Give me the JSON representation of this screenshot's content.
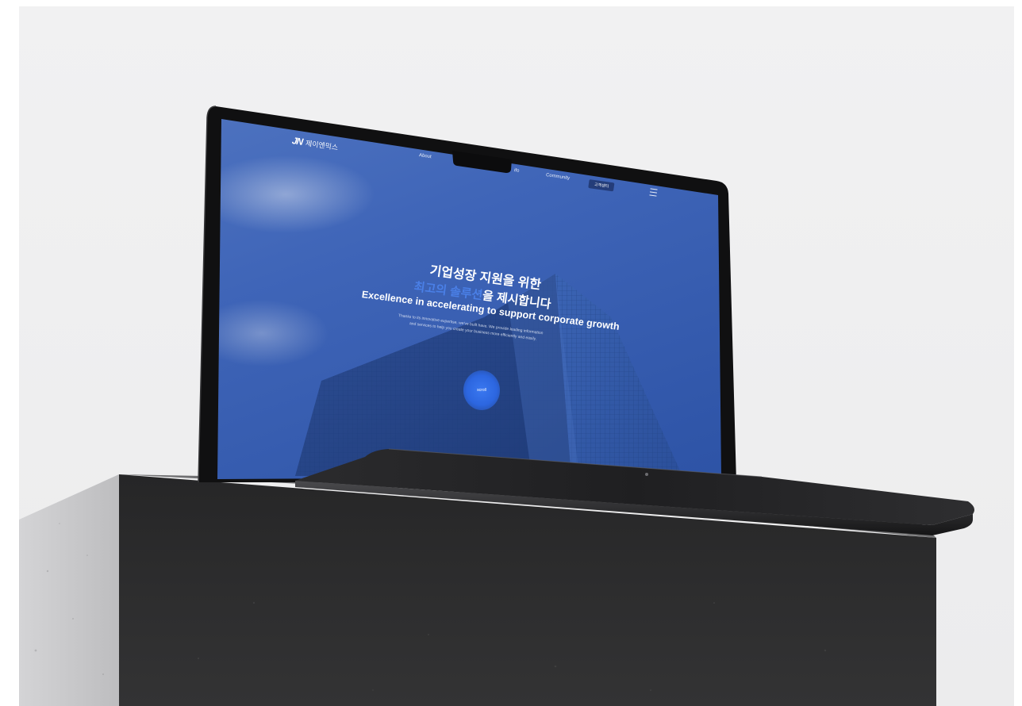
{
  "site": {
    "logo_mark": "JN",
    "logo_text": "제이엔믹스",
    "nav": {
      "about": "About",
      "item2": "ifo",
      "community": "Community",
      "cta": "고객센터"
    },
    "hero": {
      "title_line1": "기업성장 지원을 위한",
      "title_line2_accent": "최고의 솔루션",
      "title_line2_rest": "을 제시합니다",
      "title_en": "Excellence in accelerating to support corporate growth",
      "subtitle_line1": "Thanks to its innovative expertise, we've built have. We provide leading information",
      "subtitle_line2": "and services to help you create your business more efficiently and easily."
    },
    "scroll_label": "scroll"
  },
  "colors": {
    "screen_blue": "#3f65b8",
    "accent_blue": "#4a7fe6",
    "device_black": "#121212",
    "pedestal_dark": "#2a2a2b",
    "backdrop": "#f0f0f1"
  }
}
